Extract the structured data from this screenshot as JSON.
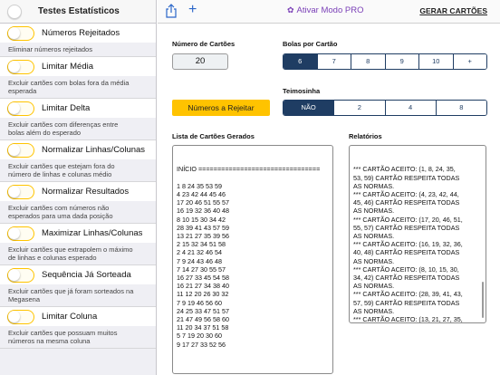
{
  "sidebar": {
    "title": "Testes Estatísticos",
    "items": [
      {
        "label": "Números Rejeitados",
        "desc": "Eliminar números rejeitados"
      },
      {
        "label": "Limitar Média",
        "desc": "Excluir cartões com bolas fora da média\nesperada"
      },
      {
        "label": "Limitar Delta",
        "desc": "Excluir cartões com diferenças entre\nbolas além do esperado"
      },
      {
        "label": "Normalizar Linhas/Colunas",
        "desc": "Excluir cartões que estejam fora do\nnúmero de linhas e colunas médio"
      },
      {
        "label": "Normalizar Resultados",
        "desc": "Excluir cartões com números não\nesperados para uma dada posição"
      },
      {
        "label": "Maximizar Linhas/Colunas",
        "desc": "Excluir cartões que extrapolem o máximo\nde linhas e colunas esperado"
      },
      {
        "label": "Sequência Já Sorteada",
        "desc": "Excluir cartões que já foram sorteados na\nMegasena"
      },
      {
        "label": "Limitar Coluna",
        "desc": "Excluir cartões que possuam muitos\nnúmeros na mesma coluna"
      }
    ]
  },
  "toolbar": {
    "share_icon": "share-icon",
    "add_icon": "plus-icon",
    "add_glyph": "+",
    "pro_label": "Ativar Modo PRO",
    "pro_gear_glyph": "✿",
    "generate_label": "GERAR CARTÕES"
  },
  "form": {
    "num_cards_label": "Número de Cartões",
    "num_cards_value": "20",
    "balls_label": "Bolas por Cartão",
    "balls_options": [
      "6",
      "7",
      "8",
      "9",
      "10",
      "+"
    ],
    "balls_selected": "6",
    "reject_button": "Números a Rejeitar",
    "teimosinha_label": "Teimosinha",
    "teimosinha_options": [
      "NÃO",
      "2",
      "4",
      "8"
    ],
    "teimosinha_selected": "NÃO"
  },
  "cards_list": {
    "label": "Lista de Cartões Gerados",
    "text": "INÍCIO ================================\n\n1 8 24 35 53 59\n4 23 42 44 45 46\n17 20 46 51 55 57\n16 19 32 36 40 48\n8 10 15 30 34 42\n28 39 41 43 57 59\n13 21 27 35 39 56\n2 15 32 34 51 58\n2 4 21 32 46 54\n7 9 24 43 46 48\n7 14 27 30 55 57\n16 27 33 45 54 58\n16 21 27 34 38 40\n11 12 20 26 30 32\n7 9 19 46 56 60\n24 25 33 47 51 57\n21 47 49 56 58 60\n11 20 34 37 51 58\n5 7 19 20 30 60\n9 17 27 33 52 56"
  },
  "reports": {
    "label": "Relatórios",
    "text": "*** CARTÃO ACEITO: (1, 8, 24, 35,\n53, 59) CARTÃO RESPEITA TODAS\nAS NORMAS.\n*** CARTÃO ACEITO: (4, 23, 42, 44,\n45, 46) CARTÃO RESPEITA TODAS\nAS NORMAS.\n*** CARTÃO ACEITO: (17, 20, 46, 51,\n55, 57) CARTÃO RESPEITA TODAS\nAS NORMAS.\n*** CARTÃO ACEITO: (16, 19, 32, 36,\n40, 48) CARTÃO RESPEITA TODAS\nAS NORMAS.\n*** CARTÃO ACEITO: (8, 10, 15, 30,\n34, 42) CARTÃO RESPEITA TODAS\nAS NORMAS.\n*** CARTÃO ACEITO: (28, 39, 41, 43,\n57, 59) CARTÃO RESPEITA TODAS\nAS NORMAS.\n*** CARTÃO ACEITO: (13, 21, 27, 35,\n39, 56) CARTÃO RESPEITA TODAS"
  },
  "colors": {
    "accent_yellow": "#ffc300",
    "segment_navy": "#1f3d63",
    "pro_purple": "#7a3fb7",
    "toolbar_blue": "#2a66c9"
  }
}
